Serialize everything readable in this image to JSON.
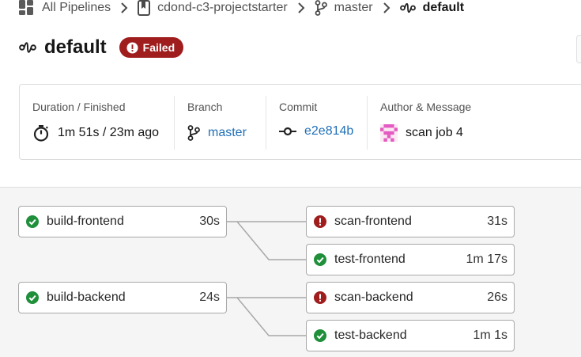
{
  "breadcrumb": {
    "all_pipelines": "All Pipelines",
    "project": "cdond-c3-projectstarter",
    "branch": "master",
    "workflow": "default"
  },
  "header": {
    "title": "default",
    "status": "Failed",
    "status_color": "#9f1d1d"
  },
  "info": {
    "duration_label": "Duration / Finished",
    "duration_value": "1m 51s / 23m ago",
    "branch_label": "Branch",
    "branch_value": "master",
    "commit_label": "Commit",
    "commit_value": "e2e814b",
    "author_label": "Author & Message",
    "author_message": "scan job 4"
  },
  "jobs": {
    "build_frontend": {
      "name": "build-frontend",
      "duration": "30s",
      "status": "success"
    },
    "scan_frontend": {
      "name": "scan-frontend",
      "duration": "31s",
      "status": "failed"
    },
    "test_frontend": {
      "name": "test-frontend",
      "duration": "1m 17s",
      "status": "success"
    },
    "build_backend": {
      "name": "build-backend",
      "duration": "24s",
      "status": "success"
    },
    "scan_backend": {
      "name": "scan-backend",
      "duration": "26s",
      "status": "failed"
    },
    "test_backend": {
      "name": "test-backend",
      "duration": "1m 1s",
      "status": "success"
    }
  },
  "colors": {
    "success": "#1f8f3a",
    "failed": "#9f1d1d",
    "link": "#1f6fb7"
  },
  "icons": {
    "all_pipelines": "dashboard-grid-icon",
    "project": "bookmark-repo-icon",
    "branch": "git-branch-icon",
    "workflow": "workflow-icon",
    "separator": "chevron-right-icon",
    "duration": "stopwatch-icon",
    "commit": "git-commit-icon",
    "author": "avatar-identicon",
    "success": "check-circle-icon",
    "failed": "exclamation-circle-icon"
  }
}
